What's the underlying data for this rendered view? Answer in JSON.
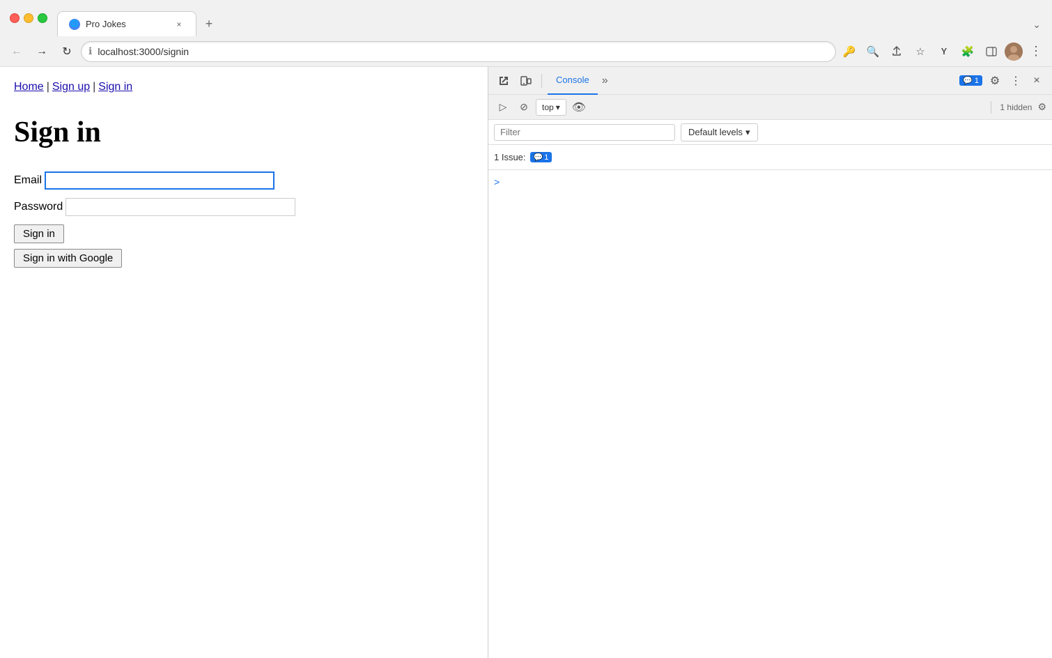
{
  "browser": {
    "tab": {
      "favicon": "🌐",
      "title": "Pro Jokes",
      "close": "×"
    },
    "new_tab": "+",
    "dropdown": "⌄"
  },
  "nav": {
    "back": "←",
    "forward": "→",
    "refresh": "↻",
    "address_icon": "ℹ",
    "url": "localhost:3000/signin",
    "key_icon": "🔑",
    "zoom_icon": "🔍",
    "share_icon": "↑",
    "bookmark_icon": "☆",
    "extension_y": "Y",
    "extensions_icon": "🧩",
    "sidebar_icon": "▭",
    "more_icon": "⋮"
  },
  "page": {
    "breadcrumb": {
      "home": "Home",
      "separator1": "|",
      "signup": "Sign up",
      "separator2": "|",
      "signin": "Sign in"
    },
    "title": "Sign in",
    "email_label": "Email",
    "email_placeholder": "",
    "password_label": "Password",
    "password_placeholder": "",
    "signin_btn": "Sign in",
    "google_btn": "Sign in with Google"
  },
  "devtools": {
    "toolbar": {
      "inspect_icon": "↖",
      "device_icon": "⧉",
      "console_tab": "Console",
      "more_icon": "»",
      "badge_icon": "💬",
      "badge_count": "1",
      "settings_icon": "⚙",
      "dots_icon": "⋮",
      "close_icon": "×"
    },
    "console_toolbar": {
      "play_icon": "▷",
      "block_icon": "⊘",
      "top_label": "top",
      "dropdown_arrow": "▾",
      "eye_icon": "👁",
      "hidden_label": "1 hidden",
      "gear_icon": "⚙"
    },
    "filter": {
      "placeholder": "Filter",
      "levels_label": "Default levels",
      "levels_arrow": "▾"
    },
    "issues": {
      "label": "1 Issue:",
      "badge_icon": "💬",
      "badge_count": "1"
    },
    "prompt_arrow": ">"
  }
}
